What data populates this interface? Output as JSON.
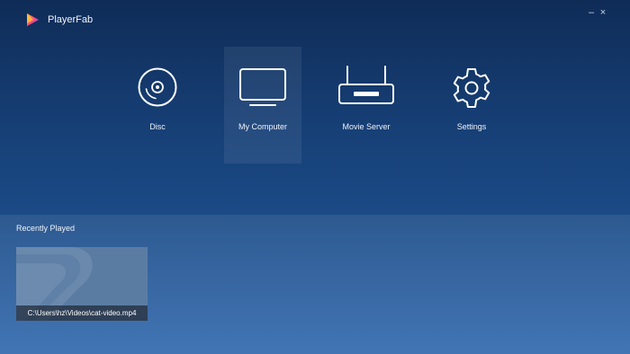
{
  "app": {
    "title": "PlayerFab"
  },
  "window_controls": {
    "minimize": "–",
    "close": "×"
  },
  "nav": [
    {
      "label": "Disc",
      "icon": "disc-icon"
    },
    {
      "label": "My Computer",
      "icon": "monitor-icon",
      "active": true
    },
    {
      "label": "Movie Server",
      "icon": "router-icon"
    },
    {
      "label": "Settings",
      "icon": "gear-icon"
    }
  ],
  "recent": {
    "title": "Recently Played",
    "items": [
      {
        "path": "C:\\Users\\hz\\Videos\\cat-video.mp4"
      }
    ]
  }
}
